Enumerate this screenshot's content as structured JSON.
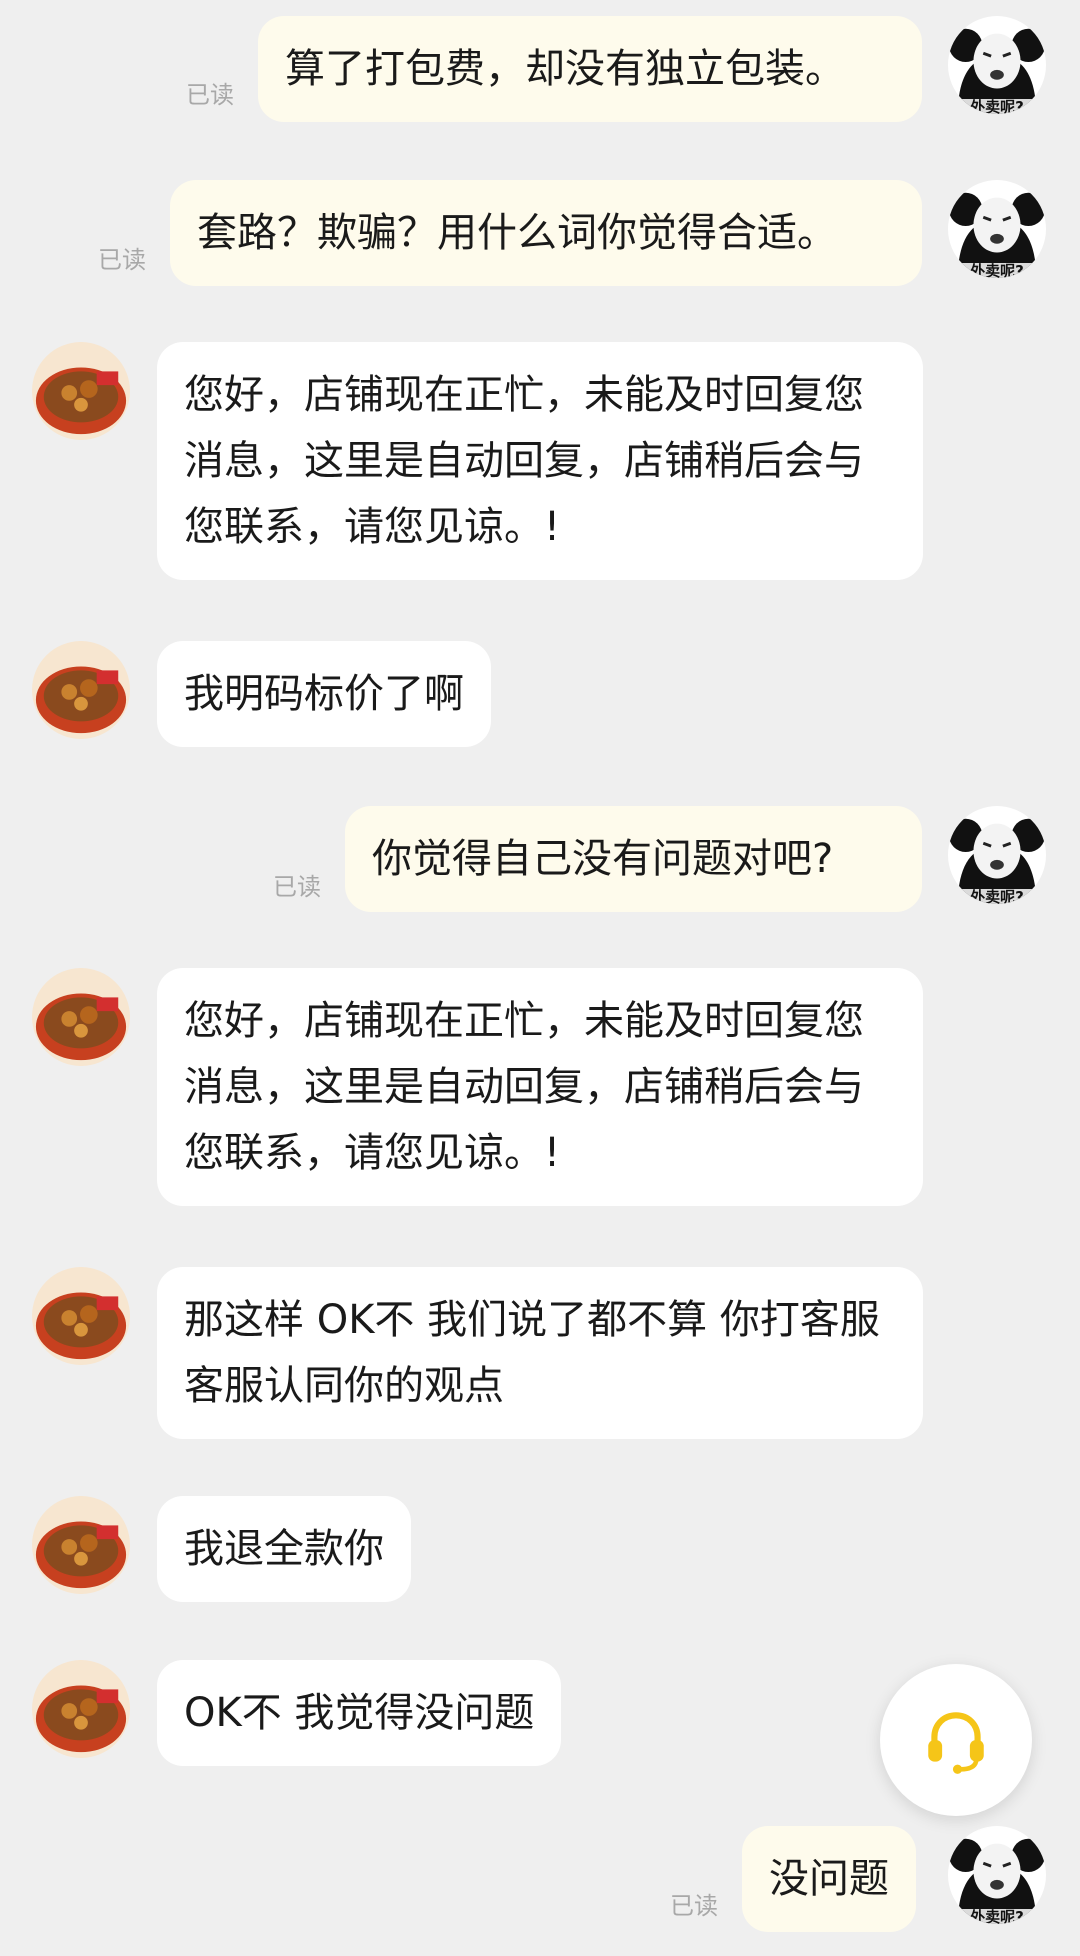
{
  "conversation": {
    "messages": [
      {
        "sender": "me",
        "text": "算了打包费，却没有独立包装。",
        "status": "已读"
      },
      {
        "sender": "me",
        "text": "套路？欺骗？用什么词你觉得合适。",
        "status": "已读"
      },
      {
        "sender": "shop",
        "text": "您好，店铺现在正忙，未能及时回复您消息，这里是自动回复，店铺稍后会与您联系，请您见谅。!"
      },
      {
        "sender": "shop",
        "text": "我明码标价了啊"
      },
      {
        "sender": "me",
        "text": "你觉得自己没有问题对吧?",
        "status": "已读"
      },
      {
        "sender": "shop",
        "text": "您好，店铺现在正忙，未能及时回复您消息，这里是自动回复，店铺稍后会与您联系，请您见谅。!"
      },
      {
        "sender": "shop",
        "text": "那这样 OK不 我们说了都不算 你打客服 客服认同你的观点"
      },
      {
        "sender": "shop",
        "text": "我退全款你"
      },
      {
        "sender": "shop",
        "text": "OK不 我觉得没问题"
      },
      {
        "sender": "me",
        "text": "没问题",
        "status": "已读"
      }
    ]
  },
  "avatars": {
    "me_caption": "外卖呢?",
    "me_icon": "panda-meme-avatar-icon",
    "shop_icon": "food-dish-avatar-icon"
  },
  "support": {
    "icon": "headset-icon",
    "color": "#f5c518"
  },
  "colors": {
    "background": "#efefef",
    "outgoing_bubble": "#fefbec",
    "incoming_bubble": "#ffffff",
    "read_text": "#a8a8a8"
  }
}
